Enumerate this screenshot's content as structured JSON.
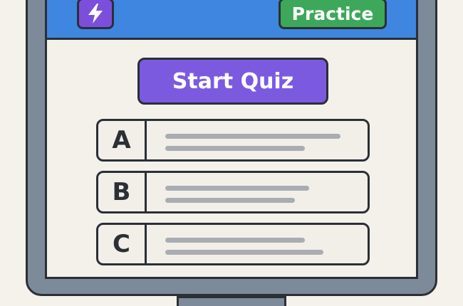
{
  "header": {
    "practice_label": "Practice",
    "logo_icon": "lightning-bolt-icon"
  },
  "main": {
    "start_quiz_label": "Start Quiz",
    "options": [
      {
        "letter": "A"
      },
      {
        "letter": "B"
      },
      {
        "letter": "C"
      }
    ]
  },
  "colors": {
    "header_bar": "#3f86e0",
    "practice_button": "#3da85a",
    "start_quiz_button": "#7b5ae0",
    "logo_tile": "#7b4fdc",
    "monitor_bezel": "#7d8a99"
  }
}
